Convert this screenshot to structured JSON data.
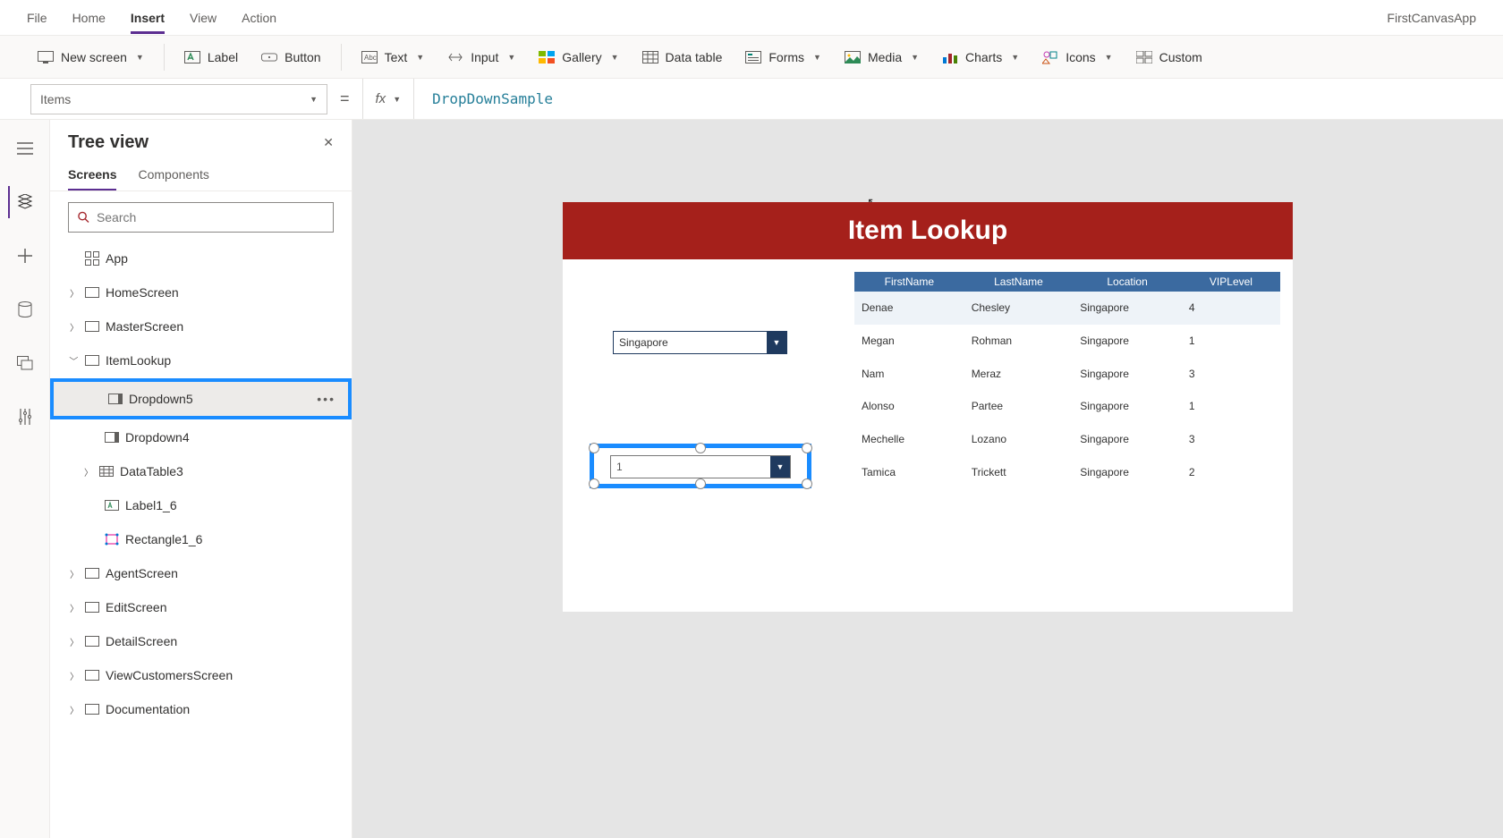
{
  "app_name": "FirstCanvasApp",
  "top_menu": [
    "File",
    "Home",
    "Insert",
    "View",
    "Action"
  ],
  "active_top_menu": "Insert",
  "ribbon": {
    "new_screen": "New screen",
    "label": "Label",
    "button": "Button",
    "text": "Text",
    "input": "Input",
    "gallery": "Gallery",
    "data_table": "Data table",
    "forms": "Forms",
    "media": "Media",
    "charts": "Charts",
    "icons": "Icons",
    "custom": "Custom"
  },
  "formula": {
    "property": "Items",
    "fx": "fx",
    "value": "DropDownSample"
  },
  "tree": {
    "title": "Tree view",
    "tabs": [
      "Screens",
      "Components"
    ],
    "active_tab": "Screens",
    "search_placeholder": "Search",
    "app_label": "App",
    "screens": [
      {
        "name": "HomeScreen",
        "expanded": false
      },
      {
        "name": "MasterScreen",
        "expanded": false
      },
      {
        "name": "ItemLookup",
        "expanded": true,
        "children": [
          {
            "name": "Dropdown5",
            "selected": true,
            "icon": "dropdown"
          },
          {
            "name": "Dropdown4",
            "icon": "dropdown"
          },
          {
            "name": "DataTable3",
            "icon": "datatable",
            "expandable": true
          },
          {
            "name": "Label1_6",
            "icon": "label"
          },
          {
            "name": "Rectangle1_6",
            "icon": "rectangle"
          }
        ]
      },
      {
        "name": "AgentScreen",
        "expanded": false
      },
      {
        "name": "EditScreen",
        "expanded": false
      },
      {
        "name": "DetailScreen",
        "expanded": false
      },
      {
        "name": "ViewCustomersScreen",
        "expanded": false
      },
      {
        "name": "Documentation",
        "expanded": false
      }
    ]
  },
  "canvas": {
    "header": "Item Lookup",
    "dropdown_value": "Singapore",
    "selected_dropdown_value": "1",
    "table": {
      "columns": [
        "FirstName",
        "LastName",
        "Location",
        "VIPLevel"
      ],
      "rows": [
        [
          "Denae",
          "Chesley",
          "Singapore",
          "4"
        ],
        [
          "Megan",
          "Rohman",
          "Singapore",
          "1"
        ],
        [
          "Nam",
          "Meraz",
          "Singapore",
          "3"
        ],
        [
          "Alonso",
          "Partee",
          "Singapore",
          "1"
        ],
        [
          "Mechelle",
          "Lozano",
          "Singapore",
          "3"
        ],
        [
          "Tamica",
          "Trickett",
          "Singapore",
          "2"
        ]
      ]
    }
  }
}
